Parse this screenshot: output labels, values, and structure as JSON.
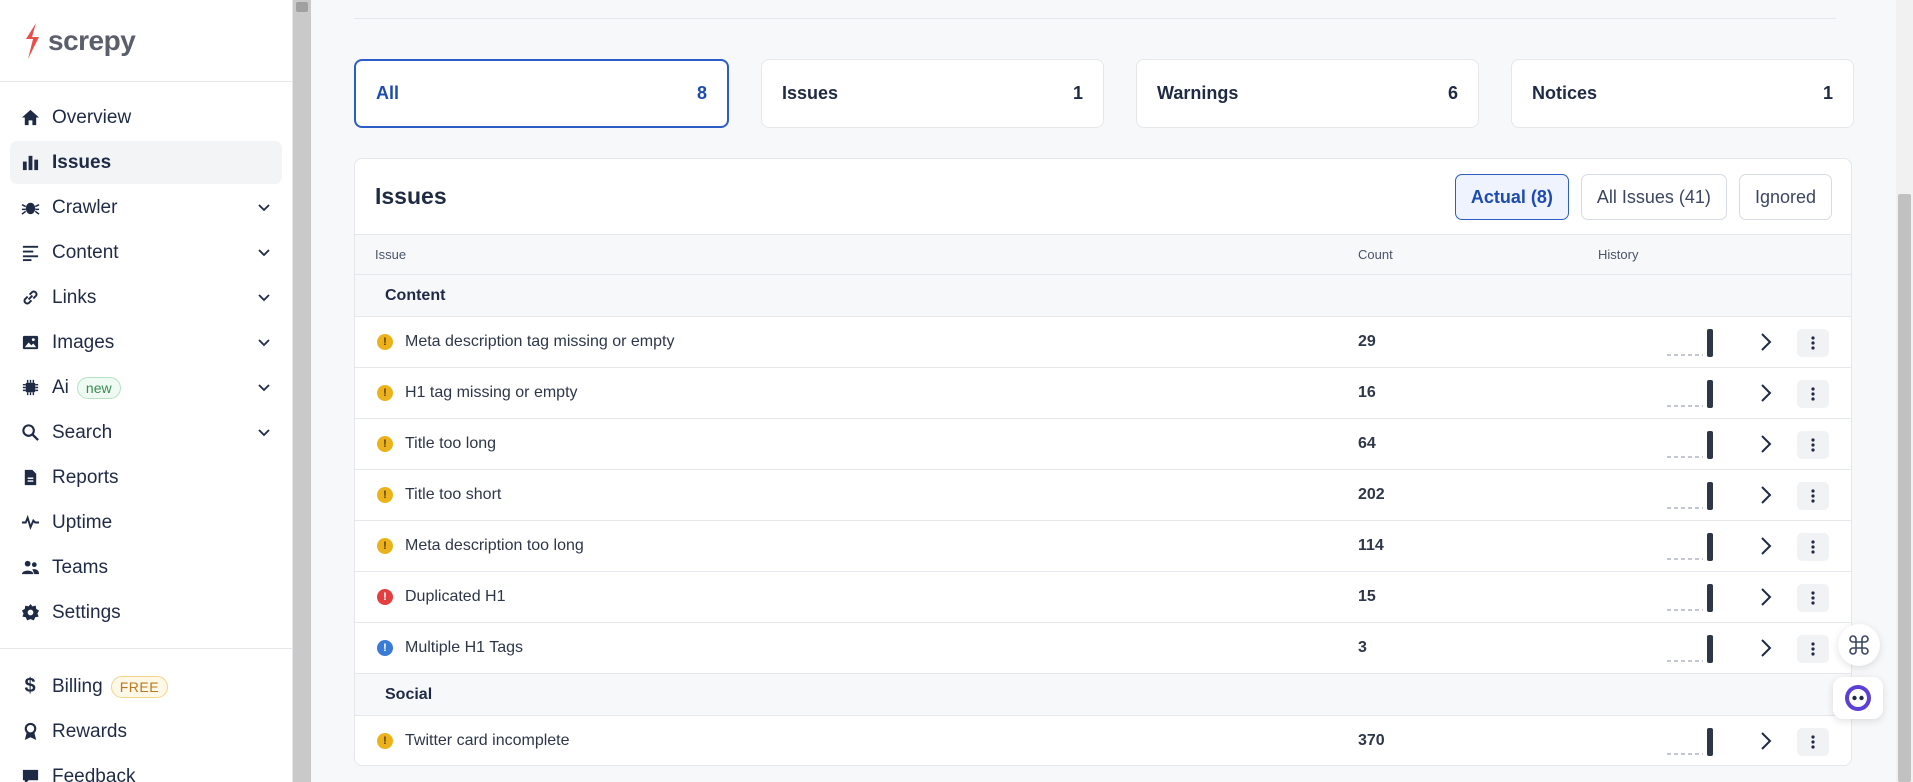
{
  "app": {
    "logo_text": "screpy"
  },
  "sidebar": {
    "items": [
      {
        "label": "Overview",
        "icon": "home-icon"
      },
      {
        "label": "Issues",
        "icon": "bar-chart-icon",
        "active": true
      },
      {
        "label": "Crawler",
        "icon": "bug-icon",
        "expandable": true
      },
      {
        "label": "Content",
        "icon": "text-align-icon",
        "expandable": true
      },
      {
        "label": "Links",
        "icon": "link-icon",
        "expandable": true
      },
      {
        "label": "Images",
        "icon": "image-icon",
        "expandable": true
      },
      {
        "label": "Ai",
        "icon": "chip-icon",
        "expandable": true,
        "badge": "new"
      },
      {
        "label": "Search",
        "icon": "search-icon",
        "expandable": true
      },
      {
        "label": "Reports",
        "icon": "document-icon"
      },
      {
        "label": "Uptime",
        "icon": "pulse-icon"
      },
      {
        "label": "Teams",
        "icon": "users-icon"
      },
      {
        "label": "Settings",
        "icon": "gear-icon"
      }
    ],
    "bottom_items": [
      {
        "label": "Billing",
        "icon": "dollar-icon",
        "badge": "FREE"
      },
      {
        "label": "Rewards",
        "icon": "award-icon"
      },
      {
        "label": "Feedback",
        "icon": "chat-icon"
      }
    ]
  },
  "summary_tabs": [
    {
      "label": "All",
      "count": "8",
      "active": true
    },
    {
      "label": "Issues",
      "count": "1"
    },
    {
      "label": "Warnings",
      "count": "6"
    },
    {
      "label": "Notices",
      "count": "1"
    }
  ],
  "issues_card": {
    "title": "Issues",
    "filters": [
      {
        "label": "Actual (8)",
        "active": true
      },
      {
        "label": "All Issues (41)"
      },
      {
        "label": "Ignored"
      }
    ],
    "columns": {
      "issue": "Issue",
      "count": "Count",
      "history": "History"
    },
    "groups": [
      {
        "name": "Content",
        "rows": [
          {
            "label": "Meta description tag missing or empty",
            "count": "29",
            "severity": "warning"
          },
          {
            "label": "H1 tag missing or empty",
            "count": "16",
            "severity": "warning"
          },
          {
            "label": "Title too long",
            "count": "64",
            "severity": "warning"
          },
          {
            "label": "Title too short",
            "count": "202",
            "severity": "warning"
          },
          {
            "label": "Meta description too long",
            "count": "114",
            "severity": "warning"
          },
          {
            "label": "Duplicated H1",
            "count": "15",
            "severity": "error"
          },
          {
            "label": "Multiple H1 Tags",
            "count": "3",
            "severity": "notice"
          }
        ]
      },
      {
        "name": "Social",
        "rows": [
          {
            "label": "Twitter card incomplete",
            "count": "370",
            "severity": "warning"
          }
        ]
      }
    ]
  },
  "colors": {
    "accent": "#2c5cc5",
    "warning": "#ecb21c",
    "error": "#e53e3e",
    "notice": "#3a7bd5",
    "logo": "#e8504a"
  }
}
